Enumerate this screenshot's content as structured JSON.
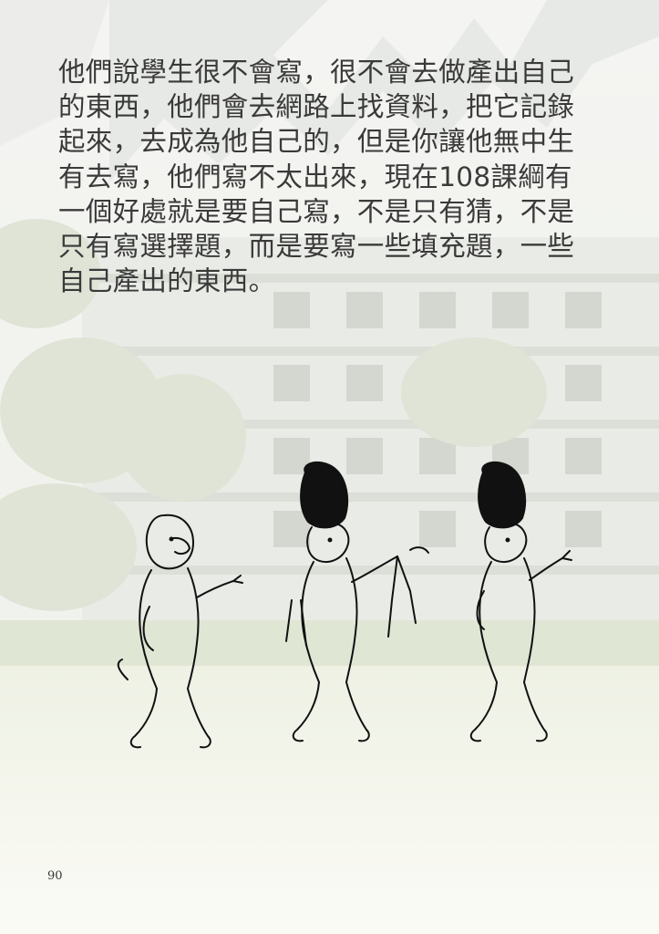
{
  "body_lines": [
    "他們說學生很不會寫，很不會去做產出自己",
    "的東西，他們會去網路上找資料，把它記錄",
    "起來，去成為他自己的，但是你讓他無中生",
    "有去寫，他們寫不太出來，現在108課綱有",
    "一個好處就是要自己寫，不是只有猜，不是",
    "只有寫選擇題，而是要寫一些填充題，一些",
    "自己產出的東西。"
  ],
  "page_number": "90",
  "colors": {
    "text": "#3a3a3a",
    "background": "#f7f8f2",
    "ink": "#111111"
  },
  "illustration": {
    "subject": "three-monkeys-ink-drawing",
    "figures": [
      "monkey",
      "monkey-with-hat-holding-branch",
      "monkey-with-hat"
    ]
  }
}
